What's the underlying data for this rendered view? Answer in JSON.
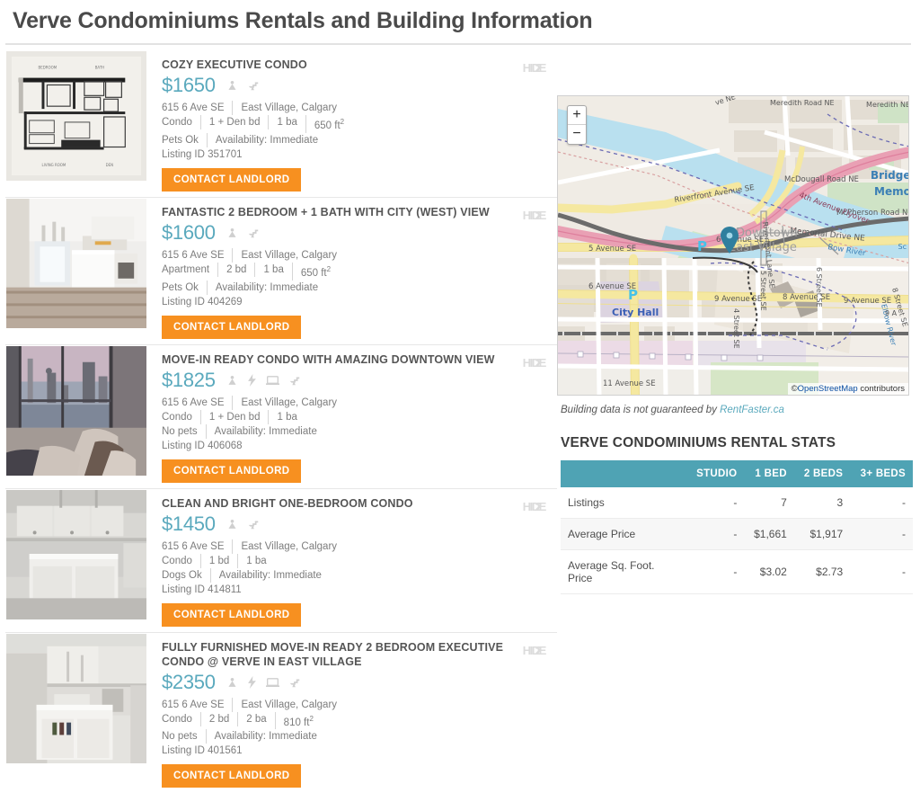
{
  "header": {
    "title": "Verve Condominiums Rentals and Building Information"
  },
  "listings": [
    {
      "title": "COZY EXECUTIVE CONDO",
      "price": "$1650",
      "hide_label": "HIDE",
      "hide_overlap": "2",
      "address": "615 6 Ave SE",
      "neighbourhood": "East Village, Calgary",
      "type": "Condo",
      "beds": "1 + Den bd",
      "baths": "1 ba",
      "size": "650 ft",
      "size_sup": "2",
      "pets": "Pets Ok",
      "availability": "Availability: Immediate",
      "listing_id": "Listing ID 351701",
      "contact_label": "CONTACT LANDLORD",
      "icons": [
        "pet-icon",
        "water-icon"
      ],
      "thumb": "floorplan"
    },
    {
      "title": "FANTASTIC 2 BEDROOM + 1 BATH WITH CITY (WEST) VIEW",
      "price": "$1600",
      "hide_label": "HIDE",
      "hide_overlap": "2",
      "address": "615 6 Ave SE",
      "neighbourhood": "East Village, Calgary",
      "type": "Apartment",
      "beds": "2 bd",
      "baths": "1 ba",
      "size": "650 ft",
      "size_sup": "2",
      "pets": "Pets Ok",
      "availability": "Availability: Immediate",
      "listing_id": "Listing ID 404269",
      "contact_label": "CONTACT LANDLORD",
      "icons": [
        "pet-icon",
        "water-icon"
      ],
      "thumb": "kitchen-white"
    },
    {
      "title": "MOVE-IN READY CONDO WITH AMAZING DOWNTOWN VIEW",
      "price": "$1825",
      "hide_label": "HIDE",
      "hide_overlap": "2",
      "address": "615 6 Ave SE",
      "neighbourhood": "East Village, Calgary",
      "type": "Condo",
      "beds": "1 + Den bd",
      "baths": "1 ba",
      "size": "",
      "size_sup": "",
      "pets": "No pets",
      "availability": "Availability: Immediate",
      "listing_id": "Listing ID 406068",
      "contact_label": "CONTACT LANDLORD",
      "icons": [
        "pet-icon",
        "electricity-icon",
        "internet-icon",
        "water-icon"
      ],
      "thumb": "bedroom-view"
    },
    {
      "title": "CLEAN AND BRIGHT ONE-BEDROOM CONDO",
      "price": "$1450",
      "hide_label": "HIDE",
      "hide_overlap": "2",
      "address": "615 6 Ave SE",
      "neighbourhood": "East Village, Calgary",
      "type": "Condo",
      "beds": "1 bd",
      "baths": "1 ba",
      "size": "",
      "size_sup": "",
      "pets": "Dogs Ok",
      "availability": "Availability: Immediate",
      "listing_id": "Listing ID 414811",
      "contact_label": "CONTACT LANDLORD",
      "icons": [
        "pet-icon",
        "water-icon"
      ],
      "thumb": "kitchen-grey"
    },
    {
      "title": "FULLY FURNISHED MOVE-IN READY 2 BEDROOM EXECUTIVE CONDO @ VERVE IN EAST VILLAGE",
      "price": "$2350",
      "hide_label": "HIDE",
      "hide_overlap": "2",
      "address": "615 6 Ave SE",
      "neighbourhood": "East Village, Calgary",
      "type": "Condo",
      "beds": "2 bd",
      "baths": "2 ba",
      "size": "810 ft",
      "size_sup": "2",
      "pets": "No pets",
      "availability": "Availability: Immediate",
      "listing_id": "Listing ID 401561",
      "contact_label": "CONTACT LANDLORD",
      "icons": [
        "pet-icon",
        "electricity-icon",
        "internet-icon",
        "water-icon"
      ],
      "thumb": "kitchen-island"
    }
  ],
  "map": {
    "zoom_in": "+",
    "zoom_out": "−",
    "attribution_prefix": "©",
    "attribution_link": "OpenStreetMap",
    "attribution_suffix": " contributors",
    "labels": [
      "Ave NE",
      "Meredith Road NE",
      "Meredith NE",
      "McDougall Road NE",
      "McPherson Road NE",
      "4th Avenue Flyover",
      "Memorial Drive NE",
      "Bridgel",
      "Memo",
      "Riverfront Avenue SE",
      "Bow River",
      "Elbow River",
      "5 Avenue SE",
      "6 Avenue SE",
      "7 Avenue SE",
      "8 Avenue SE",
      "9 Avenue SE",
      "11 Avenue SE",
      "City Hall",
      "Downtown",
      "East Village",
      "4 Street SE",
      "5 Street SE",
      "6 Street SE",
      "8 Street SE",
      "Riverfront Lane SE",
      "P",
      "9 A",
      "Sc",
      "Se"
    ],
    "marker": "map-pin"
  },
  "disclaimer": {
    "text": "Building data is not guaranteed by ",
    "link": "RentFaster.ca"
  },
  "stats": {
    "title": "VERVE CONDOMINIUMS RENTAL STATS",
    "columns": [
      "",
      "STUDIO",
      "1 BED",
      "2 BEDS",
      "3+ BEDS"
    ],
    "rows": [
      {
        "label": "Listings",
        "values": [
          "-",
          "7",
          "3",
          "-"
        ]
      },
      {
        "label": "Average Price",
        "values": [
          "-",
          "$1,661",
          "$1,917",
          "-"
        ]
      },
      {
        "label": "Average Sq. Foot. Price",
        "values": [
          "-",
          "$3.02",
          "$2.73",
          "-"
        ]
      }
    ]
  },
  "colors": {
    "accent_price": "#5aa9bd",
    "contact_button": "#f79020",
    "table_header": "#4fa3b4"
  }
}
